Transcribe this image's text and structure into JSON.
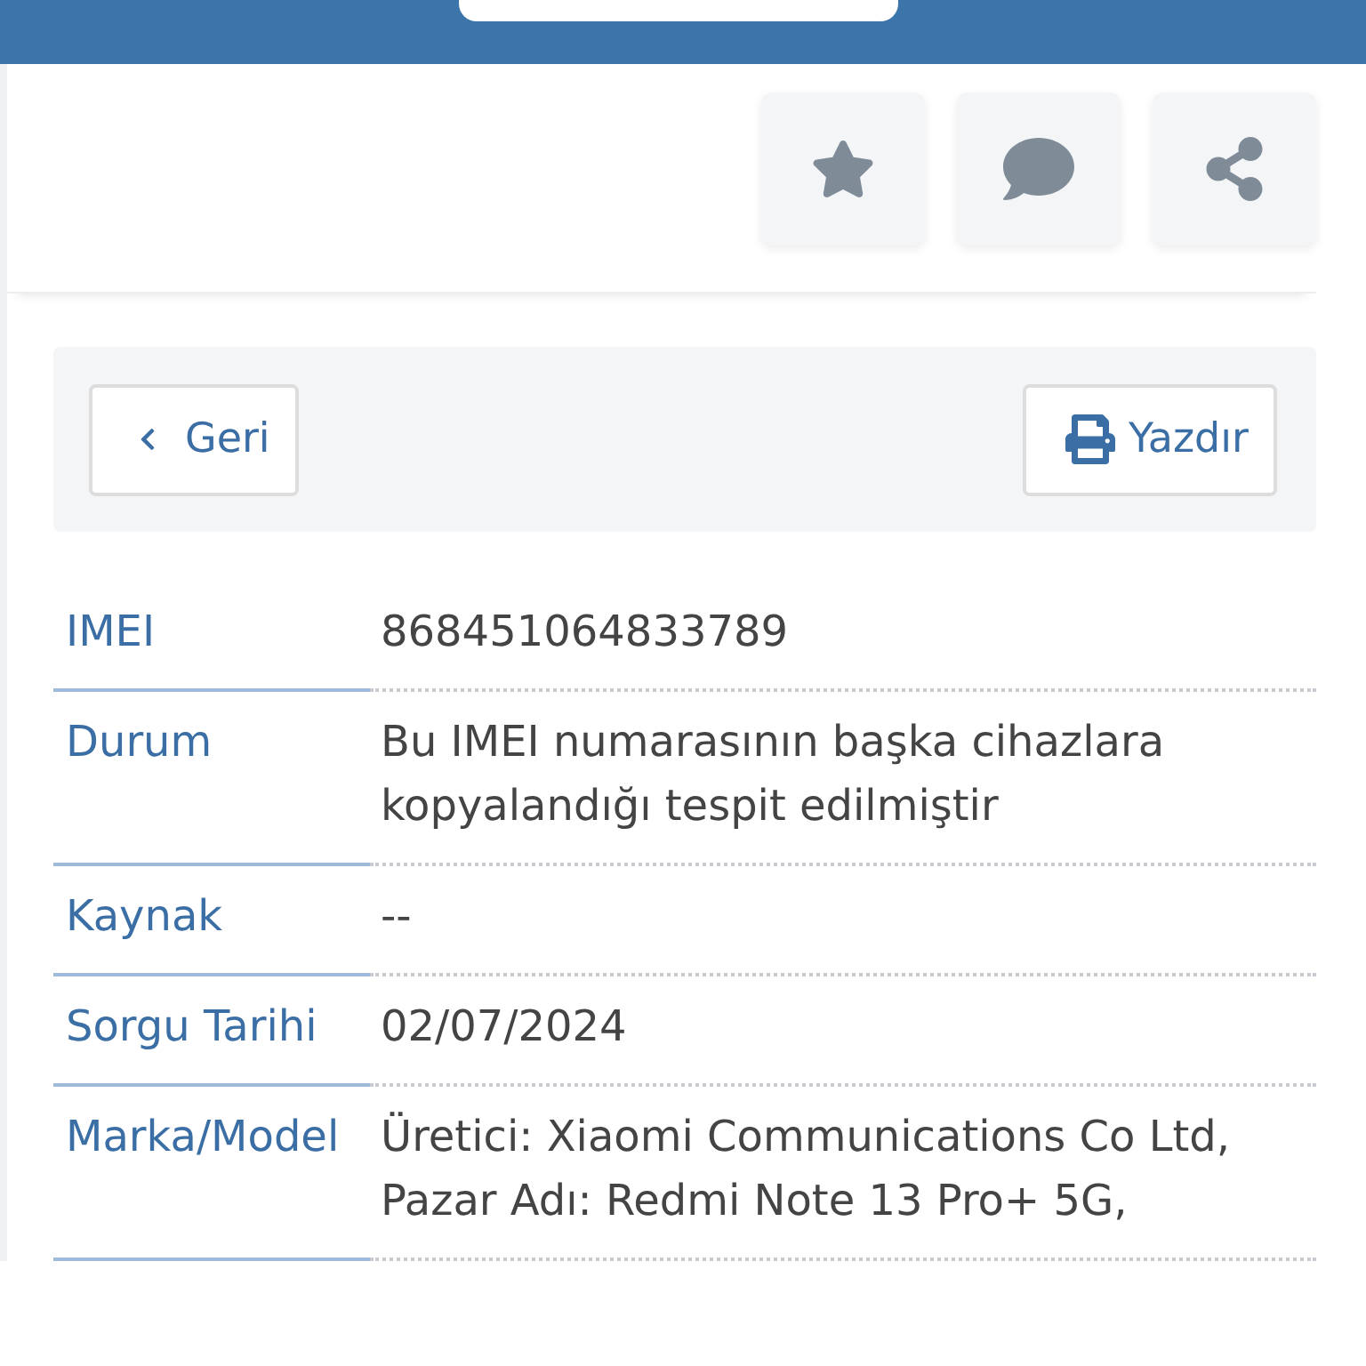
{
  "actions": [
    {
      "kind": "star"
    },
    {
      "kind": "comment"
    },
    {
      "kind": "share"
    }
  ],
  "toolbar": {
    "back": "Geri",
    "print": "Yazdır"
  },
  "details": [
    {
      "label": "IMEI",
      "value": "868451064833789"
    },
    {
      "label": "Durum",
      "value": "Bu IMEI numarasının başka cihazlara kopyalandığı tespit edilmiştir"
    },
    {
      "label": "Kaynak",
      "value": "--"
    },
    {
      "label": "Sorgu Tarihi",
      "value": "02/07/2024"
    },
    {
      "label": "Marka/Model",
      "value": "Üretici: Xiaomi Communications Co Ltd, Pazar Adı: Redmi Note 13 Pro+ 5G,"
    }
  ]
}
